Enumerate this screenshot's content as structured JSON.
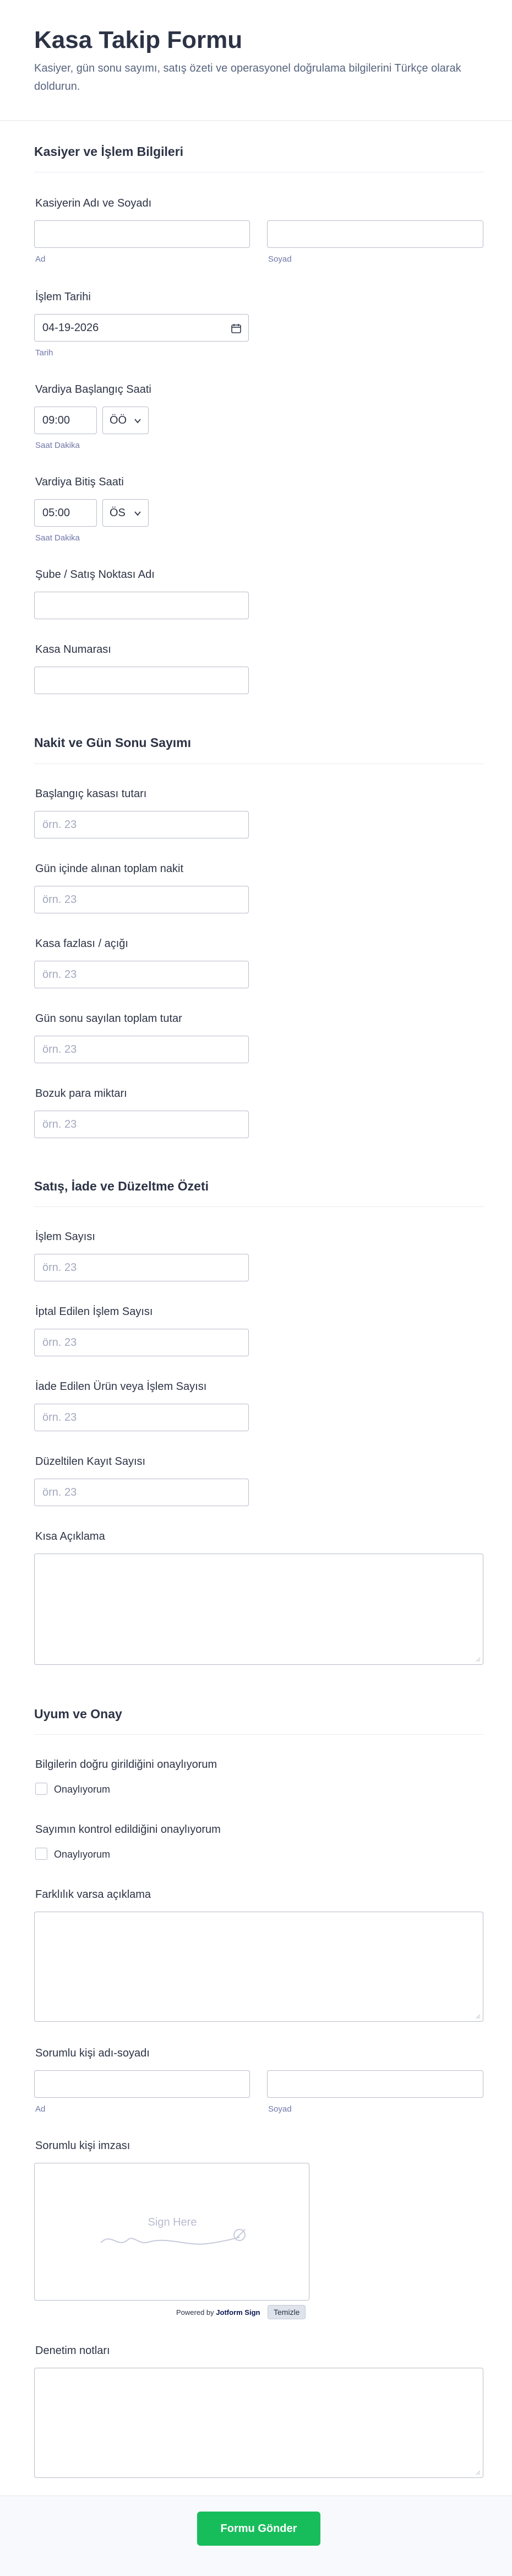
{
  "header": {
    "title": "Kasa Takip Formu",
    "subtitle": "Kasiyer, gün sonu sayımı, satış özeti ve operasyonel doğrulama bilgilerini Türkçe olarak doldurun."
  },
  "sections": {
    "s1": "Kasiyer ve İşlem Bilgileri",
    "s2": "Nakit ve Gün Sonu Sayımı",
    "s3": "Satış, İade ve Düzeltme Özeti",
    "s4": "Uyum ve Onay"
  },
  "cashier": {
    "label": "Kasiyerin Adı ve Soyadı",
    "first_sub": "Ad",
    "last_sub": "Soyad",
    "first_value": "",
    "last_value": ""
  },
  "date": {
    "label": "İşlem Tarihi",
    "value": "04-19-2026",
    "sub": "Tarih"
  },
  "shift_start": {
    "label": "Vardiya Başlangıç Saati",
    "time": "09:00",
    "ampm": "ÖÖ",
    "sub": "Saat Dakika"
  },
  "shift_end": {
    "label": "Vardiya Bitiş Saati",
    "time": "05:00",
    "ampm": "ÖS",
    "sub": "Saat Dakika"
  },
  "branch": {
    "label": "Şube / Satış Noktası Adı",
    "value": ""
  },
  "register": {
    "label": "Kasa Numarası",
    "value": ""
  },
  "placeholder_num": "örn. 23",
  "cash": {
    "opening": "Başlangıç kasası tutarı",
    "received": "Gün içinde alınan toplam nakit",
    "diff": "Kasa fazlası / açığı",
    "counted": "Gün sonu sayılan toplam tutar",
    "coins": "Bozuk para miktarı"
  },
  "sales": {
    "tx_count": "İşlem Sayısı",
    "cancelled": "İptal Edilen İşlem Sayısı",
    "returns": "İade Edilen Ürün veya İşlem Sayısı",
    "corrections": "Düzeltilen Kayıt Sayısı",
    "desc": "Kısa Açıklama"
  },
  "compliance": {
    "q1": "Bilgilerin doğru girildiğini onaylıyorum",
    "q1_opt": "Onaylıyorum",
    "q2": "Sayımın kontrol edildiğini onaylıyorum",
    "q2_opt": "Onaylıyorum",
    "diff_explain": "Farklılık varsa açıklama",
    "responsible": "Sorumlu kişi adı-soyadı",
    "resp_first_sub": "Ad",
    "resp_last_sub": "Soyad",
    "signature": "Sorumlu kişi imzası",
    "sign_here": "Sign Here",
    "powered_by": "Powered by",
    "brand": "Jotform Sign",
    "clear": "Temizle",
    "audit": "Denetim notları"
  },
  "submit": "Formu Gönder",
  "colors": {
    "accent": "#18bd5b",
    "text": "#2c3345",
    "muted": "#6f76a7",
    "border": "#b8bdc9"
  },
  "icons": [
    "calendar-icon",
    "chevron-down-icon",
    "resize-grip-icon",
    "signature-pen-icon"
  ]
}
